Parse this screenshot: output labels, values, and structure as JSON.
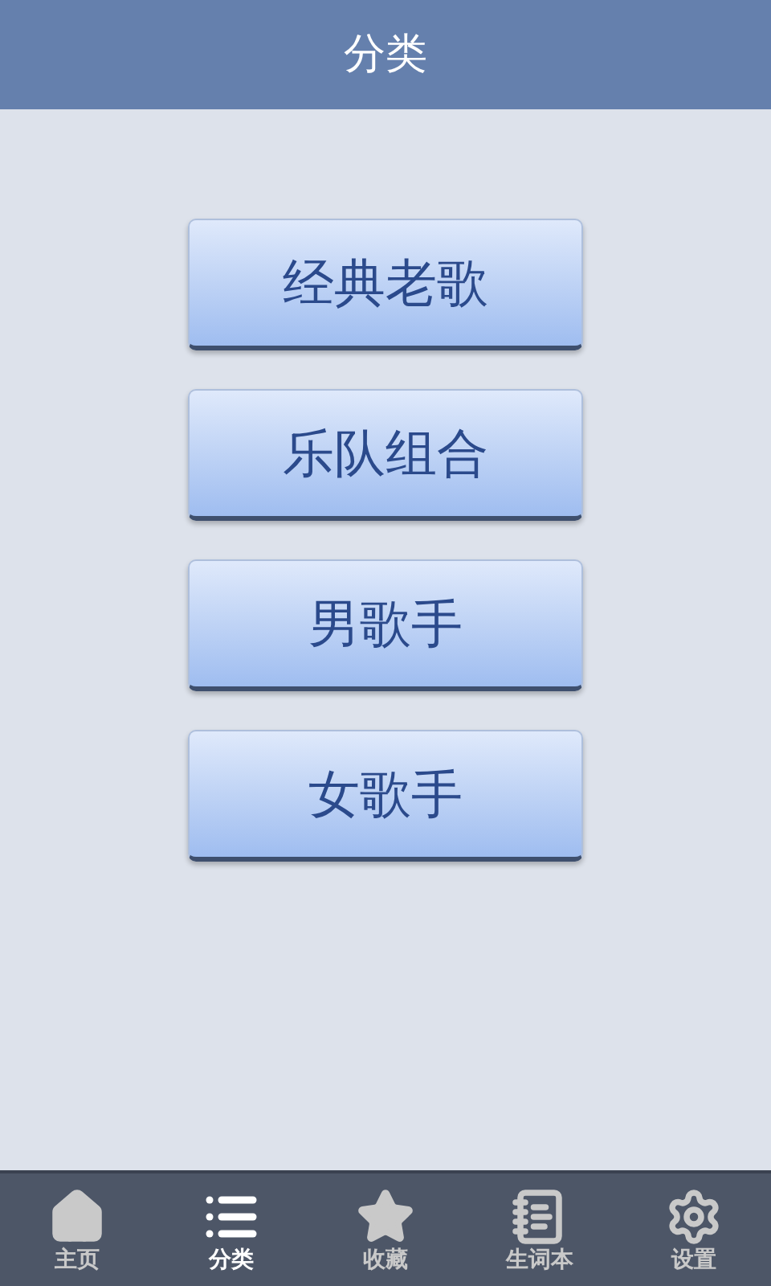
{
  "header": {
    "title": "分类"
  },
  "categories": [
    "经典老歌",
    "乐队组合",
    "男歌手",
    "女歌手"
  ],
  "tabs": [
    {
      "kind": "home",
      "label": "主页",
      "selected": false
    },
    {
      "kind": "list",
      "label": "分类",
      "selected": true
    },
    {
      "kind": "star",
      "label": "收藏",
      "selected": false
    },
    {
      "kind": "notebook",
      "label": "生词本",
      "selected": false
    },
    {
      "kind": "settings",
      "label": "设置",
      "selected": false
    }
  ]
}
